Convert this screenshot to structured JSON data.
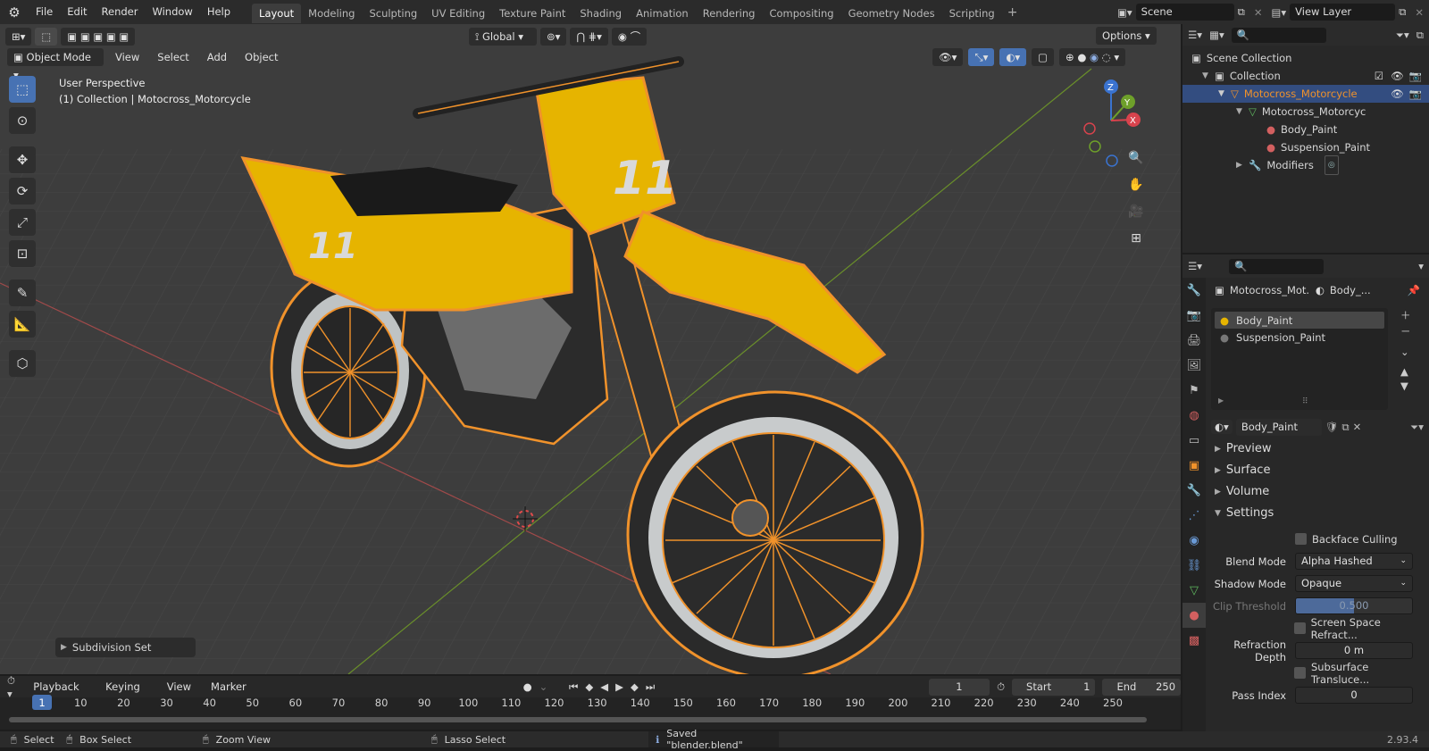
{
  "topbar": {
    "menus": [
      "File",
      "Edit",
      "Render",
      "Window",
      "Help"
    ],
    "workspaces": [
      "Layout",
      "Modeling",
      "Sculpting",
      "UV Editing",
      "Texture Paint",
      "Shading",
      "Animation",
      "Rendering",
      "Compositing",
      "Geometry Nodes",
      "Scripting"
    ],
    "active_workspace": "Layout",
    "scene": "Scene",
    "view_layer": "View Layer"
  },
  "viewport": {
    "mode": "Object Mode",
    "menus": [
      "View",
      "Select",
      "Add",
      "Object"
    ],
    "transform_orientation": "Global",
    "options_label": "Options",
    "perspective_label": "User Perspective",
    "collection_label": "(1) Collection | Motocross_Motorcycle",
    "last_op": "Subdivision Set",
    "gizmo": {
      "z": "Z",
      "y": "Y",
      "x": "X"
    },
    "bike_number": "11",
    "colors": {
      "body_yellow": "#e6b400",
      "outline_orange": "#f0922b",
      "grid_bg": "#3c3c3c"
    }
  },
  "outliner": {
    "rows": [
      {
        "label": "Scene Collection",
        "indent": 0,
        "icon": "scene-collection-icon"
      },
      {
        "label": "Collection",
        "indent": 1,
        "icon": "collection-icon"
      },
      {
        "label": "Motocross_Motorcycle",
        "indent": 2,
        "icon": "object-icon",
        "selected": true
      },
      {
        "label": "Motocross_Motorcyc",
        "indent": 3,
        "icon": "mesh-icon"
      },
      {
        "label": "Body_Paint",
        "indent": 4,
        "icon": "material-icon"
      },
      {
        "label": "Suspension_Paint",
        "indent": 4,
        "icon": "material-icon"
      },
      {
        "label": "Modifiers",
        "indent": 3,
        "icon": "wrench-icon"
      }
    ]
  },
  "properties": {
    "breadcrumb_object": "Motocross_Mot...",
    "breadcrumb_material": "Body_...",
    "slots": [
      "Body_Paint",
      "Suspension_Paint"
    ],
    "active_material": "Body_Paint",
    "panels": {
      "preview": "Preview",
      "surface": "Surface",
      "volume": "Volume",
      "settings": "Settings"
    },
    "settings": {
      "backface_culling": "Backface Culling",
      "blend_mode_label": "Blend Mode",
      "blend_mode": "Alpha Hashed",
      "shadow_mode_label": "Shadow Mode",
      "shadow_mode": "Opaque",
      "clip_threshold_label": "Clip Threshold",
      "clip_threshold": "0.500",
      "screen_space_refraction": "Screen Space Refract...",
      "refraction_depth_label": "Refraction Depth",
      "refraction_depth": "0 m",
      "subsurface_translucency": "Subsurface Transluce...",
      "pass_index_label": "Pass Index",
      "pass_index": "0"
    }
  },
  "timeline": {
    "menus": [
      "Playback",
      "Keying",
      "View",
      "Marker"
    ],
    "current_frame": "1",
    "start_label": "Start",
    "start": "1",
    "end_label": "End",
    "end": "250",
    "ticks": [
      "1",
      "10",
      "20",
      "30",
      "40",
      "50",
      "60",
      "70",
      "80",
      "90",
      "100",
      "110",
      "120",
      "130",
      "140",
      "150",
      "160",
      "170",
      "180",
      "190",
      "200",
      "210",
      "220",
      "230",
      "240",
      "250"
    ]
  },
  "statusbar": {
    "select": "Select",
    "box_select": "Box Select",
    "zoom_view": "Zoom View",
    "lasso_select": "Lasso Select",
    "message": "Saved \"blender.blend\"",
    "version": "2.93.4"
  }
}
